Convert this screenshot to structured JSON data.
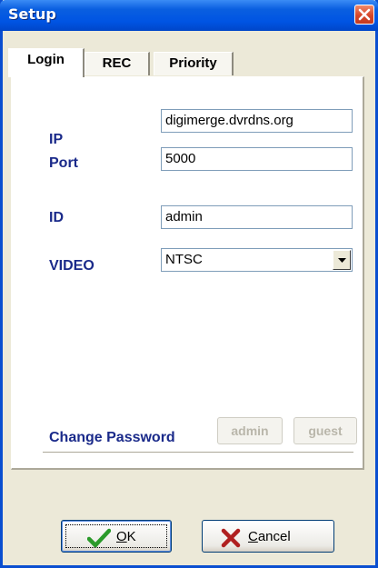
{
  "window": {
    "title": "Setup"
  },
  "tabs": [
    {
      "label": "Login",
      "active": true
    },
    {
      "label": "REC",
      "active": false
    },
    {
      "label": "Priority",
      "active": false
    }
  ],
  "login": {
    "ip_label": "IP",
    "ip_value": "digimerge.dvrdns.org",
    "port_label": "Port",
    "port_value": "5000",
    "id_label": "ID",
    "id_value": "admin",
    "video_label": "VIDEO",
    "video_value": "NTSC",
    "change_password_label": "Change Password",
    "admin_button": "admin",
    "guest_button": "guest"
  },
  "footer": {
    "ok_mnemonic": "O",
    "ok_rest": "K",
    "cancel_mnemonic": "C",
    "cancel_rest": "ancel"
  },
  "icons": {
    "ok": "check-icon",
    "cancel": "x-icon",
    "close": "close-icon",
    "dropdown": "chevron-down-icon"
  },
  "colors": {
    "title_bar": "#0054e3",
    "label_text": "#1a2a8a",
    "check_green": "#2a9a2a",
    "cancel_red": "#b02020"
  }
}
